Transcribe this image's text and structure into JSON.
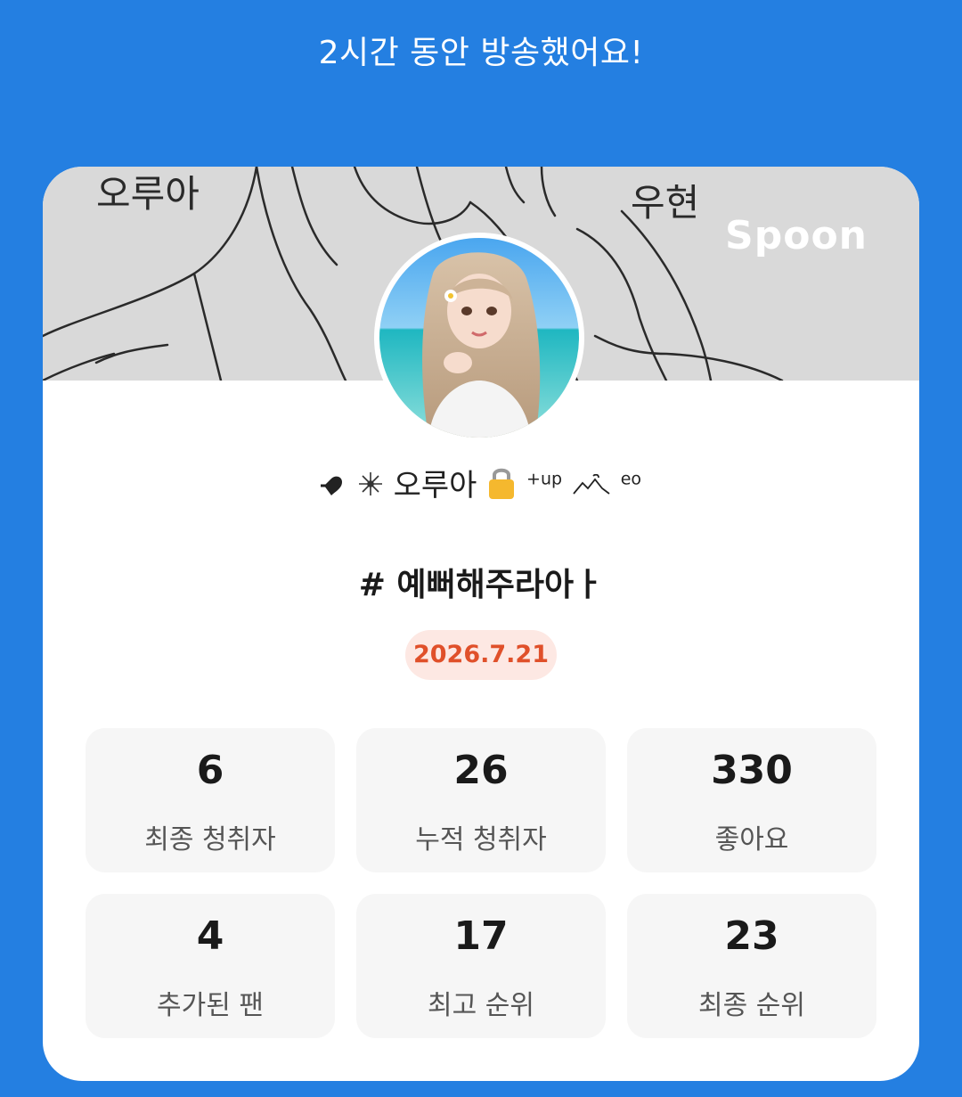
{
  "header": {
    "headline": "2시간 동안 방송했어요!"
  },
  "banner": {
    "logo_text": "Spoon",
    "doodle_text_left": "오루아",
    "doodle_text_right": "우현"
  },
  "profile": {
    "nickname_main": "오루아",
    "nickname_sup1": "+up",
    "nickname_sup2": "eo",
    "avatar_icon": "profile-photo"
  },
  "broadcast": {
    "title": "# 예뻐해주라아ㅏ",
    "date": "2026.7.21"
  },
  "stats": [
    {
      "value": "6",
      "label": "최종 청취자"
    },
    {
      "value": "26",
      "label": "누적 청취자"
    },
    {
      "value": "330",
      "label": "좋아요"
    },
    {
      "value": "4",
      "label": "추가된 팬"
    },
    {
      "value": "17",
      "label": "최고 순위"
    },
    {
      "value": "23",
      "label": "최종 순위"
    }
  ],
  "colors": {
    "background": "#247fe1",
    "date_badge_bg": "#fde8e3",
    "date_badge_text": "#e0502a",
    "stat_bg": "#f6f6f6"
  }
}
